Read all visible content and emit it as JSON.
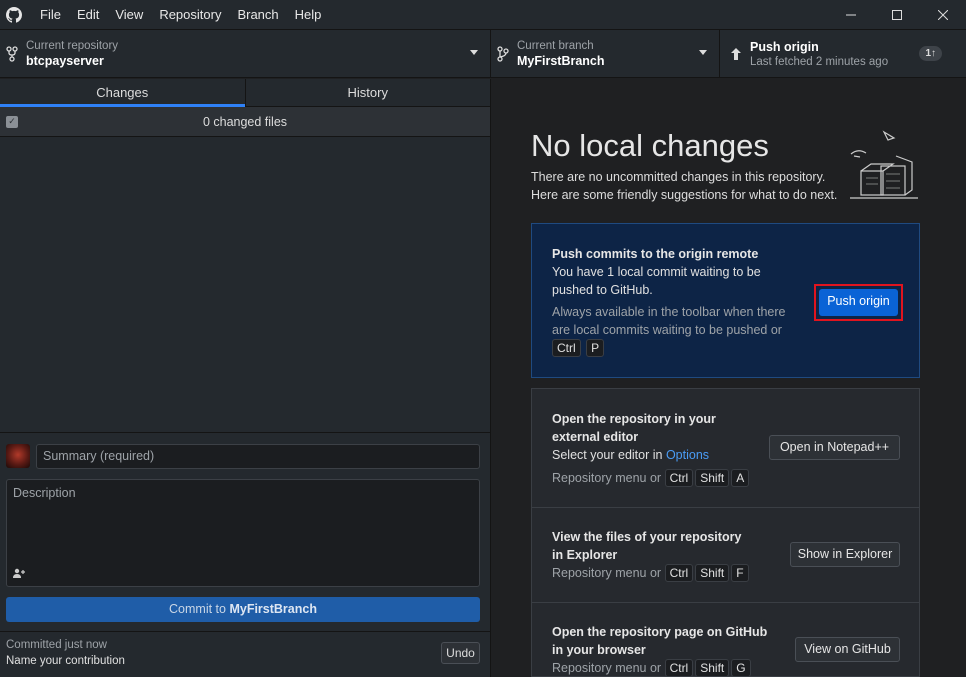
{
  "menu": [
    "File",
    "Edit",
    "View",
    "Repository",
    "Branch",
    "Help"
  ],
  "window_controls": {
    "minimize": "—",
    "maximize": "☐",
    "close": "✕"
  },
  "toolbar": {
    "repo_sub": "Current repository",
    "repo_name": "btcpayserver",
    "branch_sub": "Current branch",
    "branch_name": "MyFirstBranch",
    "push_title": "Push origin",
    "push_sub": "Last fetched 2 minutes ago",
    "push_badge": "1↑"
  },
  "tabs": {
    "changes": "Changes",
    "history": "History"
  },
  "changes": {
    "count_label": "0 changed files"
  },
  "commit": {
    "summary_placeholder": "Summary (required)",
    "description_placeholder": "Description",
    "button_prefix": "Commit to ",
    "button_branch": "MyFirstBranch"
  },
  "last_commit": {
    "sub": "Committed just now",
    "title": "Name your contribution",
    "undo": "Undo"
  },
  "main": {
    "title": "No local changes",
    "desc_line1": "There are no uncommitted changes in this repository.",
    "desc_line2": "Here are some friendly suggestions for what to do next."
  },
  "push_card": {
    "title": "Push commits to the origin remote",
    "body": "You have 1 local commit waiting to be pushed to GitHub.",
    "hint": "Always available in the toolbar when there are local commits waiting to be pushed or",
    "key1": "Ctrl",
    "key2": "P",
    "button": "Push origin"
  },
  "editor_card": {
    "title": "Open the repository in your external editor",
    "body_prefix": "Select your editor in ",
    "body_link": "Options",
    "hint": "Repository menu or",
    "keys": [
      "Ctrl",
      "Shift",
      "A"
    ],
    "button": "Open in Notepad++"
  },
  "explorer_card": {
    "title": "View the files of your repository in Explorer",
    "hint": "Repository menu or",
    "keys": [
      "Ctrl",
      "Shift",
      "F"
    ],
    "button": "Show in Explorer"
  },
  "github_card": {
    "title": "Open the repository page on GitHub in your browser",
    "hint": "Repository menu or",
    "keys": [
      "Ctrl",
      "Shift",
      "G"
    ],
    "button": "View on GitHub"
  },
  "colors": {
    "accent": "#2f81f7",
    "push_button": "#0a63d6",
    "highlight_border": "#e0141e",
    "link": "#4a9cf5"
  }
}
